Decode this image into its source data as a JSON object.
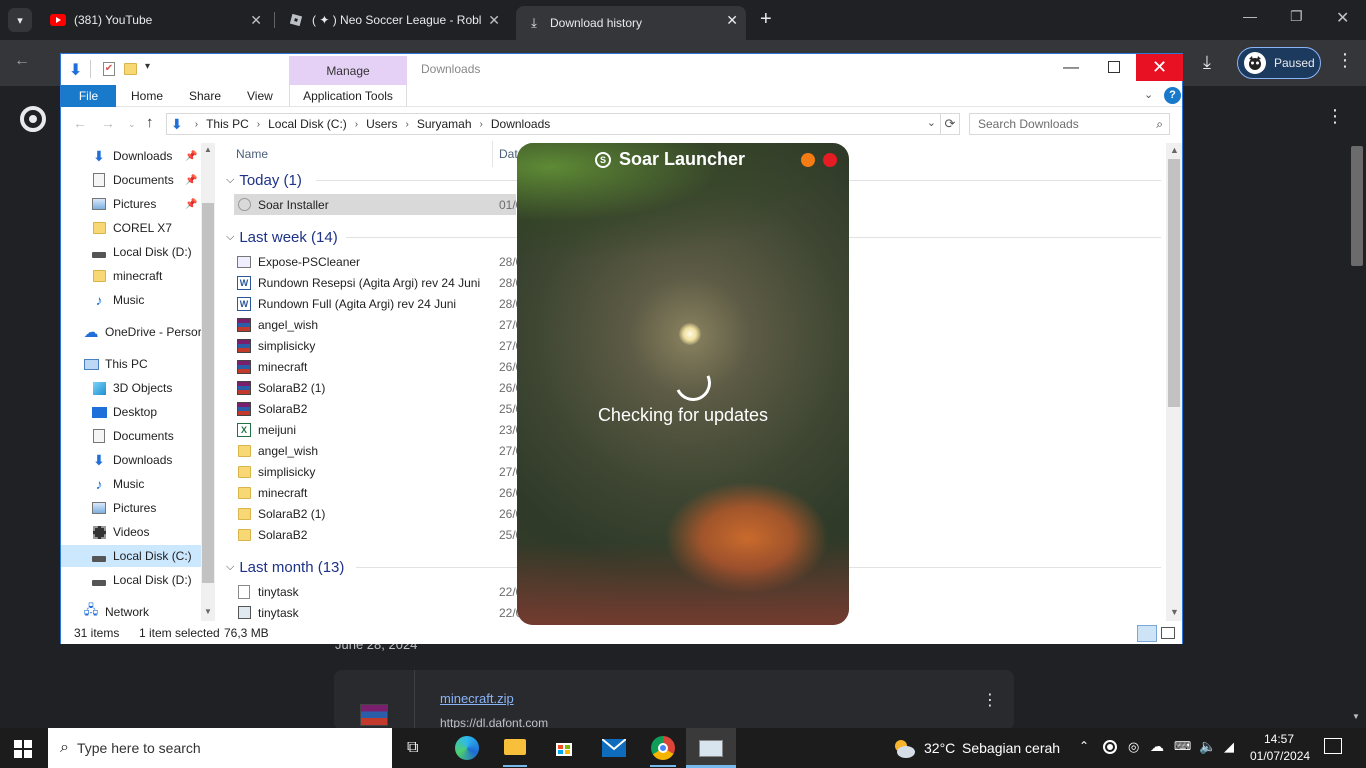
{
  "browser": {
    "tabs": [
      {
        "label": "(381) YouTube",
        "icon": "youtube-icon"
      },
      {
        "label": "( ✦ ) Neo Soccer League - Roblo",
        "icon": "roblox-icon"
      },
      {
        "label": "Download history",
        "icon": "download-icon"
      }
    ],
    "paused_label": "Paused"
  },
  "page_behind": {
    "date_text": "June 28, 2024",
    "file_name": "minecraft.zip",
    "file_url": "https://dl.dafont.com"
  },
  "explorer": {
    "manage_label": "Manage",
    "title": "Downloads",
    "ribbon_tabs": [
      "File",
      "Home",
      "Share",
      "View",
      "Application Tools"
    ],
    "breadcrumb": [
      "This PC",
      "Local Disk (C:)",
      "Users",
      "Suryamah",
      "Downloads"
    ],
    "search_placeholder": "Search Downloads",
    "columns": {
      "name": "Name",
      "date": "Date"
    },
    "nav": [
      {
        "label": "Downloads",
        "icon": "download-arrow-icon",
        "pinned": true
      },
      {
        "label": "Documents",
        "icon": "document-icon",
        "pinned": true
      },
      {
        "label": "Pictures",
        "icon": "pictures-icon",
        "pinned": true
      },
      {
        "label": "COREL X7",
        "icon": "folder-icon"
      },
      {
        "label": "Local Disk (D:)",
        "icon": "drive-icon"
      },
      {
        "label": "minecraft",
        "icon": "folder-icon"
      },
      {
        "label": "Music",
        "icon": "music-icon"
      },
      {
        "label": "OneDrive - Persor",
        "icon": "onedrive-icon"
      },
      {
        "label": "This PC",
        "icon": "pc-icon"
      },
      {
        "label": "3D Objects",
        "icon": "3d-objects-icon"
      },
      {
        "label": "Desktop",
        "icon": "desktop-icon"
      },
      {
        "label": "Documents",
        "icon": "document-icon"
      },
      {
        "label": "Downloads",
        "icon": "download-arrow-icon"
      },
      {
        "label": "Music",
        "icon": "music-icon"
      },
      {
        "label": "Pictures",
        "icon": "pictures-icon"
      },
      {
        "label": "Videos",
        "icon": "videos-icon"
      },
      {
        "label": "Local Disk (C:)",
        "icon": "drive-icon",
        "selected": true
      },
      {
        "label": "Local Disk (D:)",
        "icon": "drive-icon"
      },
      {
        "label": "Network",
        "icon": "network-icon"
      }
    ],
    "groups": [
      {
        "label": "Today (1)",
        "files": [
          {
            "name": "Soar Installer",
            "date": "01/0",
            "icon": "installer-icon",
            "selected": true
          }
        ]
      },
      {
        "label": "Last week (14)",
        "files": [
          {
            "name": "Expose-PSCleaner",
            "date": "28/0",
            "icon": "script-icon"
          },
          {
            "name": "Rundown Resepsi (Agita Argi) rev 24 Juni",
            "date": "28/0",
            "icon": "word-icon"
          },
          {
            "name": "Rundown Full (Agita Argi) rev 24 Juni",
            "date": "28/0",
            "icon": "word-icon"
          },
          {
            "name": "angel_wish",
            "date": "27/0",
            "icon": "winrar-icon"
          },
          {
            "name": "simplisicky",
            "date": "27/0",
            "icon": "winrar-icon"
          },
          {
            "name": "minecraft",
            "date": "26/0",
            "icon": "winrar-icon"
          },
          {
            "name": "SolaraB2 (1)",
            "date": "26/0",
            "icon": "winrar-icon"
          },
          {
            "name": "SolaraB2",
            "date": "25/0",
            "icon": "winrar-icon"
          },
          {
            "name": "meijuni",
            "date": "23/0",
            "icon": "excel-icon"
          },
          {
            "name": "angel_wish",
            "date": "27/0",
            "icon": "folder-icon"
          },
          {
            "name": "simplisicky",
            "date": "27/0",
            "icon": "folder-icon"
          },
          {
            "name": "minecraft",
            "date": "26/0",
            "icon": "folder-icon"
          },
          {
            "name": "SolaraB2 (1)",
            "date": "26/0",
            "icon": "folder-icon"
          },
          {
            "name": "SolaraB2",
            "date": "25/0",
            "icon": "folder-icon"
          }
        ]
      },
      {
        "label": "Last month (13)",
        "files": [
          {
            "name": "tinytask",
            "date": "22/0",
            "icon": "file-icon"
          },
          {
            "name": "tinytask",
            "date": "22/0",
            "icon": "app-icon"
          }
        ]
      }
    ],
    "status": {
      "count": "31 items",
      "selection": "1 item selected",
      "size": "76,3 MB"
    }
  },
  "launcher": {
    "title": "Soar Launcher",
    "status": "Checking for updates",
    "colors": {
      "minimize": "#f57c14",
      "close": "#e51c23"
    }
  },
  "taskbar": {
    "search_placeholder": "Type here to search",
    "weather_temp": "32°C",
    "weather_desc": "Sebagian cerah",
    "time": "14:57",
    "date": "01/07/2024"
  }
}
